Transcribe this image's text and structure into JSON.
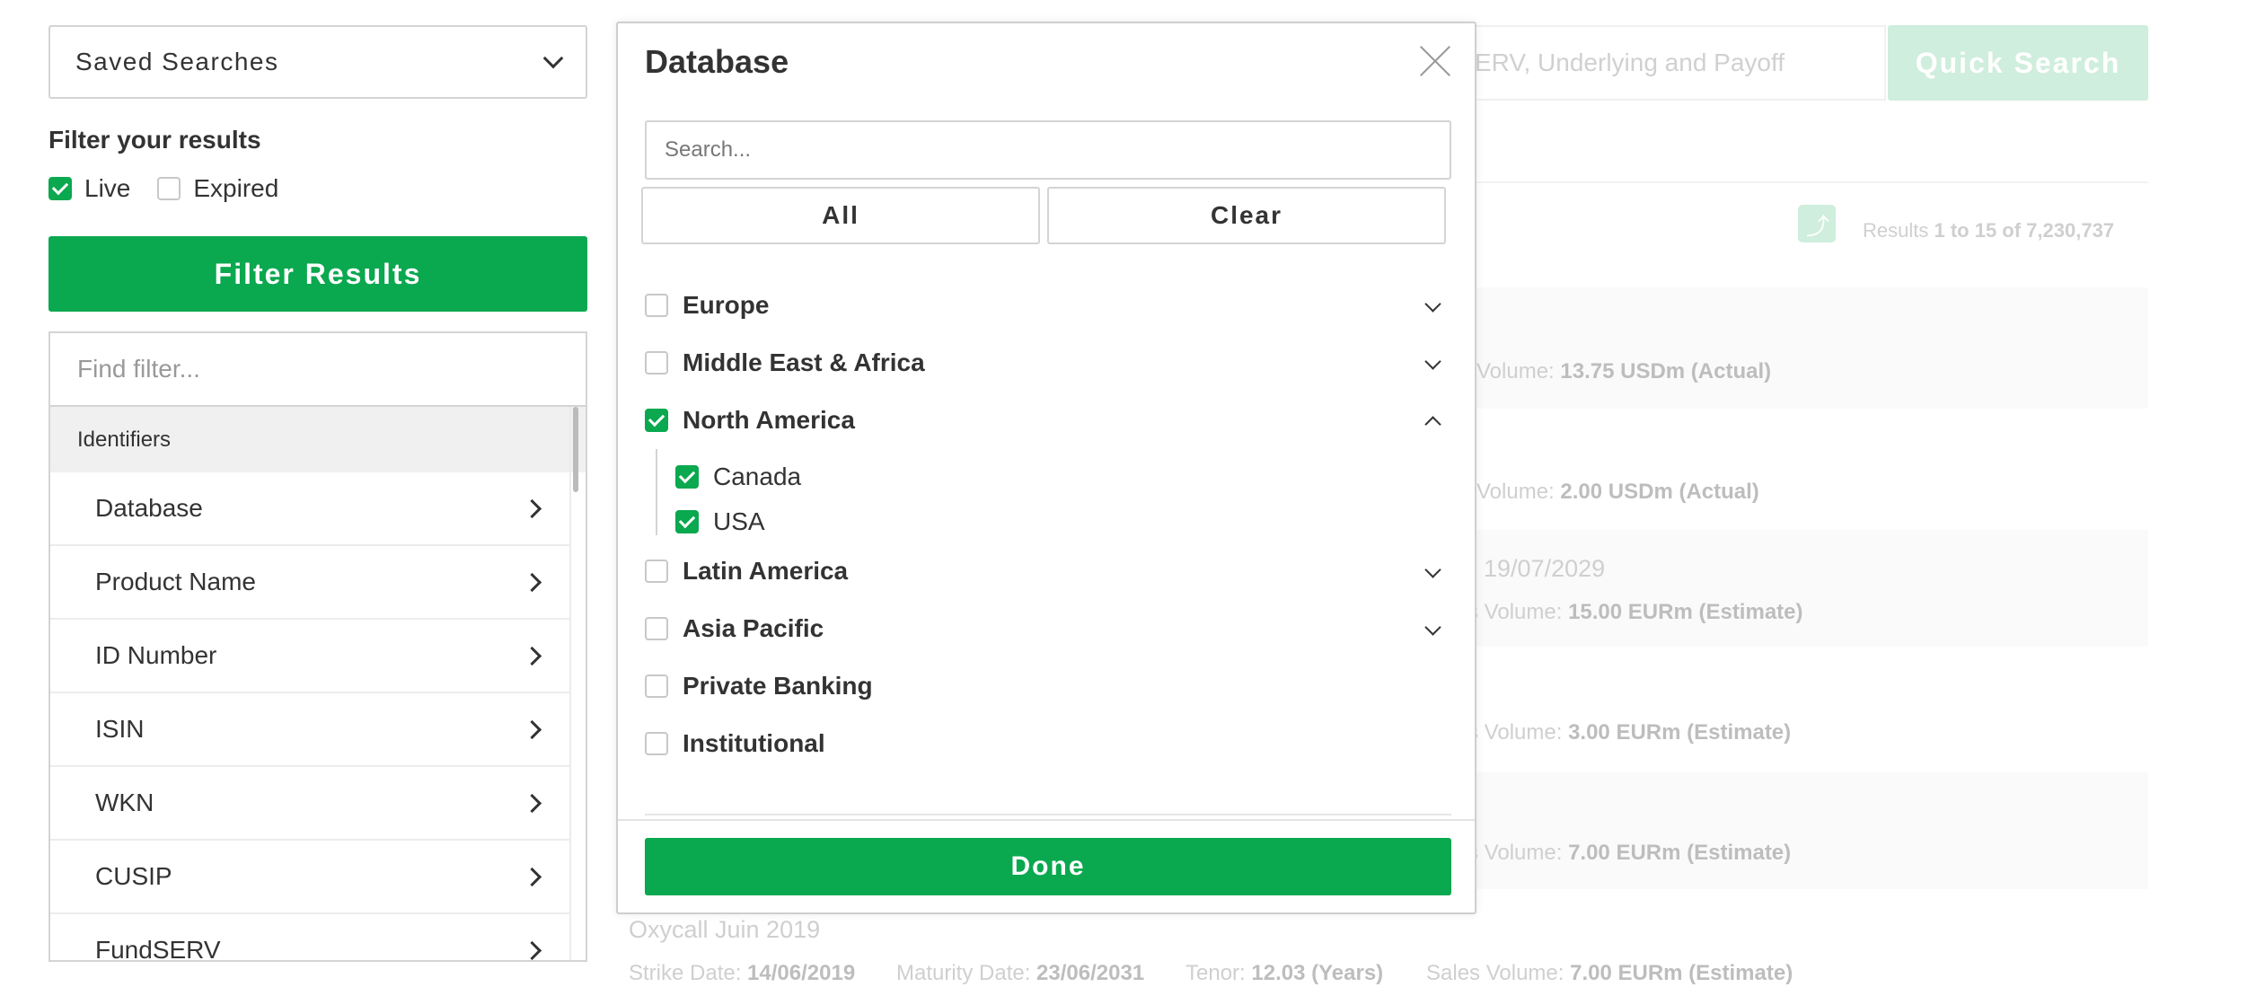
{
  "sidebar": {
    "saved_searches": "Saved Searches",
    "filter_title": "Filter your results",
    "status": [
      {
        "label": "Live",
        "checked": true
      },
      {
        "label": "Expired",
        "checked": false
      }
    ],
    "filter_button": "Filter Results",
    "find_placeholder": "Find filter...",
    "group_label": "Identifiers",
    "items": [
      "Database",
      "Product Name",
      "ID Number",
      "ISIN",
      "WKN",
      "CUSIP",
      "FundSERV"
    ]
  },
  "background": {
    "search_placeholder": "ERV, Underlying and Payoff",
    "quick_search": "Quick Search",
    "results_prefix": "Results ",
    "results_range": "1 to 15 of 7,230,737",
    "rows": [
      {
        "text": "Volume: ",
        "value": "13.75 USDm (Actual)"
      },
      {
        "text": "Volume: ",
        "value": "2.00 USDm (Actual)"
      },
      {
        "date": "19/07/2029",
        "text": "s Volume: ",
        "value": "15.00 EURm (Estimate)"
      },
      {
        "text": "s Volume: ",
        "value": "3.00 EURm (Estimate)"
      },
      {
        "text": "s Volume: ",
        "value": "7.00 EURm (Estimate)"
      }
    ],
    "last_product": {
      "name": "Oxycall Juin 2019",
      "strike_label": "Strike Date: ",
      "strike": "14/06/2019",
      "maturity_label": "Maturity Date: ",
      "maturity": "23/06/2031",
      "tenor_label": "Tenor: ",
      "tenor": "12.03 (Years)",
      "sales_label": "Sales Volume: ",
      "sales": "7.00 EURm (Estimate)"
    }
  },
  "modal": {
    "title": "Database",
    "search_placeholder": "Search...",
    "all_button": "All",
    "clear_button": "Clear",
    "regions": [
      {
        "label": "Europe",
        "checked": false,
        "expandable": true,
        "expanded": false
      },
      {
        "label": "Middle East & Africa",
        "checked": false,
        "expandable": true,
        "expanded": false
      },
      {
        "label": "North America",
        "checked": true,
        "expandable": true,
        "expanded": true,
        "children": [
          {
            "label": "Canada",
            "checked": true
          },
          {
            "label": "USA",
            "checked": true
          }
        ]
      },
      {
        "label": "Latin America",
        "checked": false,
        "expandable": true,
        "expanded": false
      },
      {
        "label": "Asia Pacific",
        "checked": false,
        "expandable": true,
        "expanded": false
      },
      {
        "label": "Private Banking",
        "checked": false,
        "expandable": false
      },
      {
        "label": "Institutional",
        "checked": false,
        "expandable": false
      }
    ],
    "done_button": "Done"
  },
  "colors": {
    "accent": "#0aa84f",
    "border": "#d4d4d4"
  }
}
